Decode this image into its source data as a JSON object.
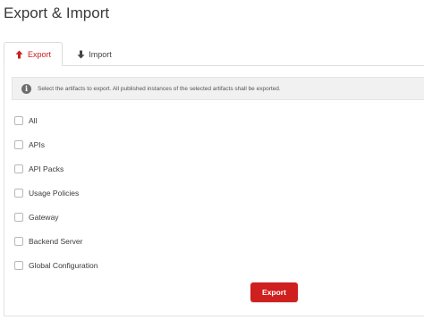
{
  "page": {
    "title": "Export & Import"
  },
  "tabs": [
    {
      "label": "Export",
      "icon": "arrow-up-icon",
      "active": true
    },
    {
      "label": "Import",
      "icon": "arrow-down-icon",
      "active": false
    }
  ],
  "info": {
    "icon": "info-icon",
    "text": "Select the artifacts to export. All published instances of the selected artifacts shall be exported."
  },
  "artifacts": [
    {
      "label": "All",
      "checked": false
    },
    {
      "label": "APIs",
      "checked": false
    },
    {
      "label": "API Packs",
      "checked": false
    },
    {
      "label": "Usage Policies",
      "checked": false
    },
    {
      "label": "Gateway",
      "checked": false
    },
    {
      "label": "Backend Server",
      "checked": false
    },
    {
      "label": "Global Configuration",
      "checked": false
    }
  ],
  "actions": {
    "export_label": "Export"
  },
  "colors": {
    "accent": "#cf1f1f",
    "active_tab_text": "#cc1f1f",
    "info_bg": "#f1f1f1"
  }
}
